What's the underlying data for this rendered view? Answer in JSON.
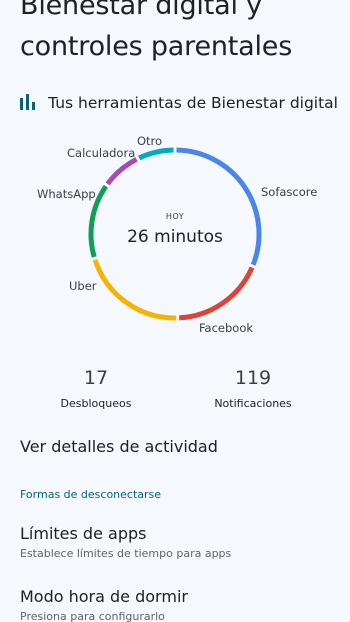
{
  "header": {
    "title_line1": "Bienestar digital y",
    "title_line2": "controles parentales"
  },
  "tools": {
    "icon": "bar-chart-icon",
    "label": "Tus herramientas de Bienestar digital"
  },
  "chart_data": {
    "type": "pie",
    "style": "donut",
    "center_caption": "HOY",
    "center_value": "26 minutos",
    "slices": [
      {
        "label": "Sofascore",
        "value": 30.0,
        "color": "#4a86e8"
      },
      {
        "label": "Facebook",
        "value": 17.5,
        "color": "#db4437"
      },
      {
        "label": "Uber",
        "value": 20.0,
        "color": "#f4b400"
      },
      {
        "label": "WhatsApp",
        "value": 14.0,
        "color": "#0f9d58"
      },
      {
        "label": "Calculadora",
        "value": 7.5,
        "color": "#ab47bc"
      },
      {
        "label": "Otro",
        "value": 7.0,
        "color": "#00acc1"
      }
    ]
  },
  "stats": {
    "unlocks": {
      "value": "17",
      "label": "Desbloqueos"
    },
    "notifications": {
      "value": "119",
      "label": "Notificaciones"
    }
  },
  "activity_link": "Ver detalles de actividad",
  "disconnect_section": {
    "header": "Formas de desconectarse",
    "items": [
      {
        "title": "Límites de apps",
        "subtitle": "Establece límites de tiempo para apps"
      },
      {
        "title": "Modo hora de dormir",
        "subtitle": "Presiona para configurarlo"
      }
    ]
  }
}
